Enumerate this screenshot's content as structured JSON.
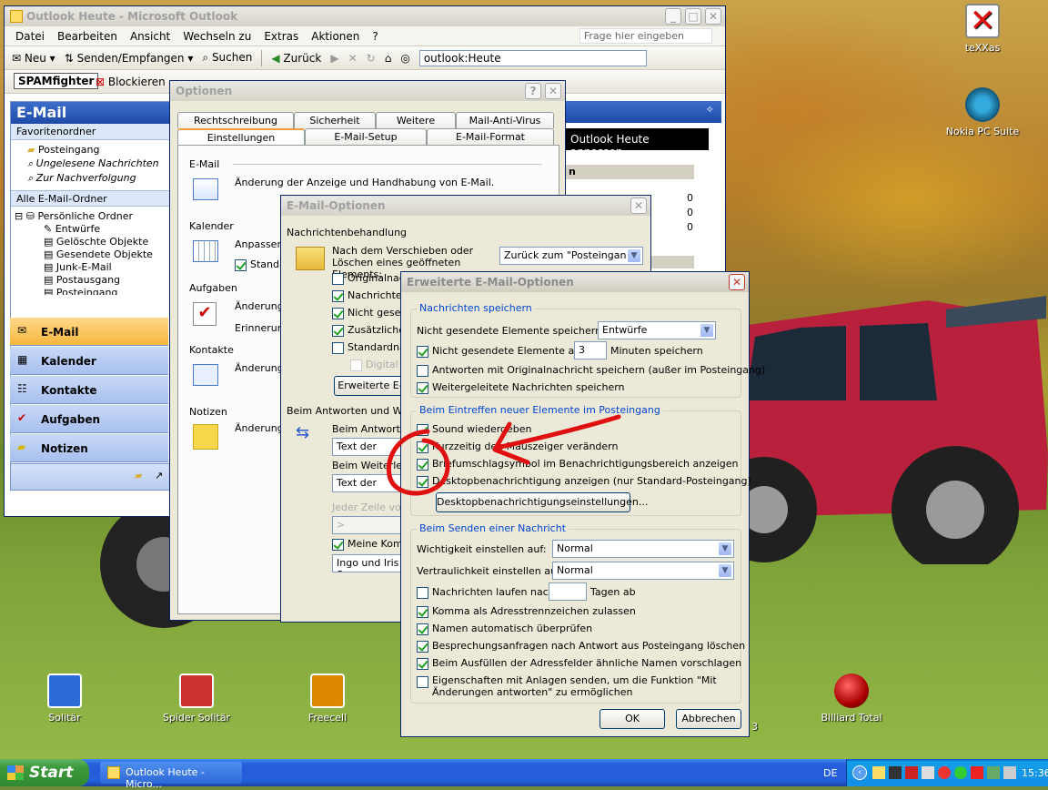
{
  "desktop": {
    "icons": [
      {
        "id": "texxas",
        "label": "teXXas"
      },
      {
        "id": "nokia",
        "label": "Nokia PC Suite"
      },
      {
        "id": "solitaire",
        "label": "Solitär"
      },
      {
        "id": "spider",
        "label": "Spider Solitär"
      },
      {
        "id": "freecell",
        "label": "Freecell"
      },
      {
        "id": "billiard",
        "label": "Billiard Total"
      },
      {
        "id": "partial3",
        "label": "3"
      }
    ]
  },
  "outlook": {
    "title": "Outlook Heute - Microsoft Outlook",
    "menu": [
      "Datei",
      "Bearbeiten",
      "Ansicht",
      "Wechseln zu",
      "Extras",
      "Aktionen",
      "?"
    ],
    "help_placeholder": "Frage hier eingeben",
    "toolbar": {
      "new": "Neu",
      "sendrecv": "Senden/Empfangen",
      "search": "Suchen",
      "back": "Zurück",
      "address": "outlook:Heute"
    },
    "spam": {
      "brand": "SPAMfighter",
      "block": "Blockieren"
    },
    "nav": {
      "header": "E-Mail",
      "favorites": "Favoritenordner",
      "fav_items": [
        "Posteingang",
        "Ungelesene Nachrichten",
        "Zur Nachverfolgung"
      ],
      "all_folders": "Alle E-Mail-Ordner",
      "root": "Persönliche Ordner",
      "folders": [
        "Entwürfe",
        "Gelöschte Objekte",
        "Gesendete Objekte",
        "Junk-E-Mail",
        "Postausgang",
        "Posteingang"
      ],
      "buttons": [
        "E-Mail",
        "Kalender",
        "Kontakte",
        "Aufgaben",
        "Notizen"
      ]
    },
    "today": {
      "customize": "Outlook Heute anpassen ...",
      "col_header": "n",
      "counts": [
        "0",
        "0",
        "0"
      ]
    }
  },
  "options": {
    "title": "Optionen",
    "tabs_row1": [
      "Rechtschreibung",
      "Sicherheit",
      "Weitere",
      "Mail-Anti-Virus"
    ],
    "tabs_row2": [
      "Einstellungen",
      "E-Mail-Setup",
      "E-Mail-Format"
    ],
    "sections": [
      {
        "label": "E-Mail",
        "text": "Änderung der Anzeige und Handhabung von E-Mail."
      },
      {
        "label": "Kalender",
        "text": "Anpassen",
        "check": "Standa"
      },
      {
        "label": "Aufgaben",
        "text": "Änderung",
        "text2": "Erinnerung"
      },
      {
        "label": "Kontakte",
        "text": "Änderung"
      },
      {
        "label": "Notizen",
        "text": "Änderung"
      }
    ]
  },
  "email_options": {
    "title": "E-Mail-Optionen",
    "handling": "Nachrichtenbehandlung",
    "after_move": "Nach dem Verschieben oder Löschen eines geöffneten Elements:",
    "after_move_value": "Zurück zum \"Posteingang\"",
    "checks": [
      {
        "label": "Originalnach",
        "checked": false
      },
      {
        "label": "Nachrichtenf",
        "checked": true
      },
      {
        "label": "Nicht gesend",
        "checked": true
      },
      {
        "label": "Zusätzliche Z",
        "checked": true
      },
      {
        "label": "Standardnach",
        "checked": false
      }
    ],
    "digital": "Digital si",
    "advanced_btn": "Erweiterte E-M",
    "reply_section": "Beim Antworten und Weite",
    "reply_label": "Beim Antworten",
    "reply_value": "Text der urspr",
    "forward_label": "Beim Weiterleite",
    "forward_value": "Text der urspr",
    "prefix": "Jeder Zeile vora",
    "prefix_value": ">",
    "comments": "Meine Komm",
    "name_value": "Ingo und Iris S"
  },
  "advanced": {
    "title": "Erweiterte E-Mail-Optionen",
    "save": {
      "title": "Nachrichten speichern",
      "unsent_in": "Nicht gesendete Elemente speichern in:",
      "unsent_folder": "Entwürfe",
      "autosave_pre": "Nicht gesendete Elemente alle",
      "autosave_value": "3",
      "autosave_post": "Minuten speichern",
      "reply_orig": "Antworten mit Originalnachricht speichern (außer im Posteingang)",
      "forwarded": "Weitergeleitete Nachrichten speichern"
    },
    "arrive": {
      "title": "Beim Eintreffen neuer Elemente im Posteingang",
      "sound": "Sound wiedergeben",
      "cursor": "Kurzzeitig den Mauszeiger verändern",
      "envelope": "Briefumschlagsymbol im Benachrichtigungsbereich anzeigen",
      "desktop": "Desktopbenachrichtigung anzeigen (nur Standard-Posteingang)",
      "desktop_btn": "Desktopbenachrichtigungseinstellungen..."
    },
    "send": {
      "title": "Beim Senden einer Nachricht",
      "importance": "Wichtigkeit einstellen auf:",
      "importance_value": "Normal",
      "sensitivity": "Vertraulichkeit einstellen auf:",
      "sensitivity_value": "Normal",
      "expire_pre": "Nachrichten laufen nach",
      "expire_post": "Tagen ab",
      "comma": "Komma als Adresstrennzeichen zulassen",
      "check_names": "Namen automatisch überprüfen",
      "delete_meeting": "Besprechungsanfragen nach Antwort aus Posteingang löschen",
      "suggest": "Beim Ausfüllen der Adressfelder ähnliche Namen vorschlagen",
      "attach_props": "Eigenschaften mit Anlagen senden, um die Funktion \"Mit Änderungen antworten\" zu ermöglichen"
    },
    "ok": "OK",
    "cancel": "Abbrechen"
  },
  "taskbar": {
    "start": "Start",
    "task": "Outlook Heute - Micro...",
    "lang": "DE",
    "time": "15:36"
  }
}
